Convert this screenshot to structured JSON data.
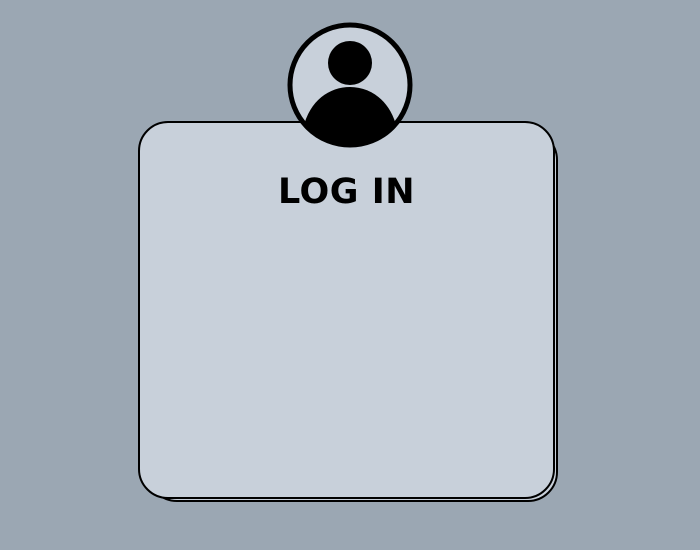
{
  "login": {
    "title": "LOG IN"
  },
  "avatar": {
    "icon": "user-icon"
  },
  "colors": {
    "background": "#9ba7b3",
    "card": "#c8d0da",
    "card_shadow": "#c8d0da",
    "outline": "#000000",
    "avatar_fill": "#c8d0da",
    "avatar_glyph": "#000000"
  }
}
